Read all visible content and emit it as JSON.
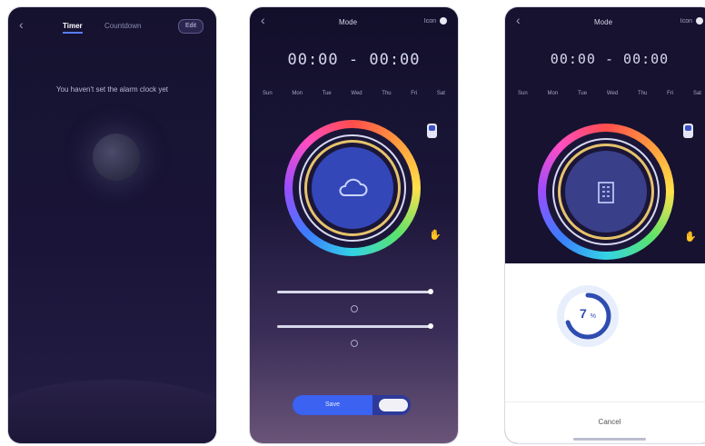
{
  "screen1": {
    "back_icon": "chevron-left-icon",
    "tabs": [
      {
        "label": "Timer",
        "active": true
      },
      {
        "label": "Countdown",
        "active": false
      }
    ],
    "edit_button": "Edit",
    "empty_message": "You haven't set the alarm clock yet"
  },
  "screen2": {
    "back_icon": "chevron-left-icon",
    "title": "Mode",
    "top_right_label": "Icon",
    "time_range": "00:00 - 00:00",
    "days": [
      "Sun",
      "Mon",
      "Tue",
      "Wed",
      "Thu",
      "Fri",
      "Sat"
    ],
    "center_icon": "cloud-icon",
    "save_label": "Save"
  },
  "screen3": {
    "back_icon": "chevron-left-icon",
    "title": "Mode",
    "top_right_label": "Icon",
    "time_range": "00:00 - 00:00",
    "days": [
      "Sun",
      "Mon",
      "Tue",
      "Wed",
      "Thu",
      "Fri",
      "Sat"
    ],
    "center_icon": "building-icon",
    "progress_value": "7",
    "progress_unit": "%",
    "progress_fraction": 0.07,
    "cancel_label": "Cancel"
  },
  "colors": {
    "accent": "#3b62f0",
    "progress": "#2f4db0"
  }
}
